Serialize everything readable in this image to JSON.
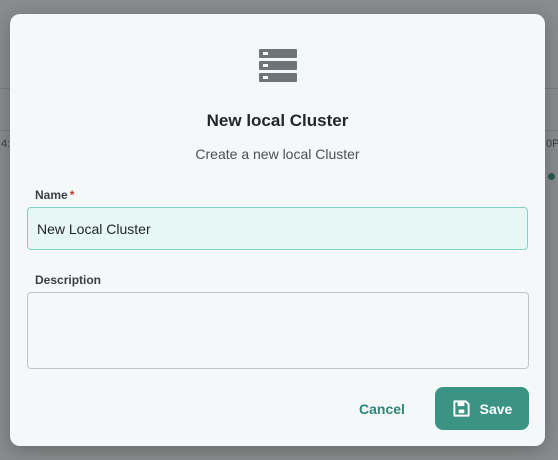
{
  "background": {
    "tick_left": "4:",
    "tick_right": "0P"
  },
  "dialog": {
    "icon": "server-stack-icon",
    "title": "New local Cluster",
    "subtitle": "Create a new local Cluster",
    "name_field": {
      "label": "Name",
      "required_mark": "*",
      "value": "New Local Cluster"
    },
    "description_field": {
      "label": "Description",
      "value": ""
    },
    "cancel_label": "Cancel",
    "save_label": "Save",
    "save_icon": "floppy-disk-icon"
  },
  "colors": {
    "accent": "#3a9383",
    "accent_text": "#2b8778",
    "input_active_bg": "#e7f7f3",
    "input_active_border": "#7fd3c2",
    "required": "#c0392b"
  }
}
